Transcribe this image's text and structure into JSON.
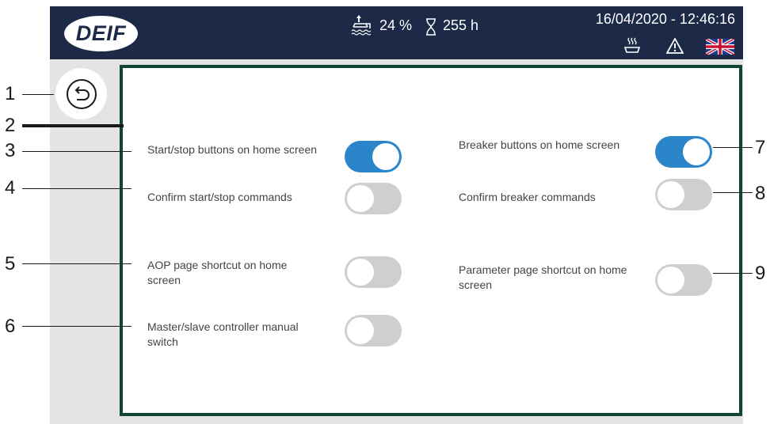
{
  "topbar": {
    "logo_text": "DEIF",
    "fuel_level": "24 %",
    "running_hours": "255 h",
    "datetime": "16/04/2020 - 12:46:16",
    "icons": [
      "fuel-icon",
      "hourglass-icon",
      "heater-icon",
      "warning-icon",
      "uk-flag-icon"
    ]
  },
  "back_button": {
    "icon": "back-arrow-icon"
  },
  "settings": {
    "start_stop_buttons": {
      "label": "Start/stop buttons on home screen",
      "on": true
    },
    "confirm_start_stop": {
      "label": "Confirm start/stop commands",
      "on": false
    },
    "aop_shortcut": {
      "label": "AOP page shortcut on home screen",
      "on": false
    },
    "master_slave": {
      "label": "Master/slave controller manual switch",
      "on": false
    },
    "breaker_buttons": {
      "label": "Breaker buttons on home screen",
      "on": true
    },
    "confirm_breaker": {
      "label": "Confirm breaker commands",
      "on": false
    },
    "parameter_shortcut": {
      "label": "Parameter page shortcut on home screen",
      "on": false
    }
  },
  "callouts": [
    "1",
    "2",
    "3",
    "4",
    "5",
    "6",
    "7",
    "8",
    "9"
  ],
  "colors": {
    "topbar": "#1c2a48",
    "panel_border": "#0f4630",
    "toggle_on": "#2a86c8",
    "toggle_off": "#cfcfcf",
    "background": "#e4e4e4"
  }
}
